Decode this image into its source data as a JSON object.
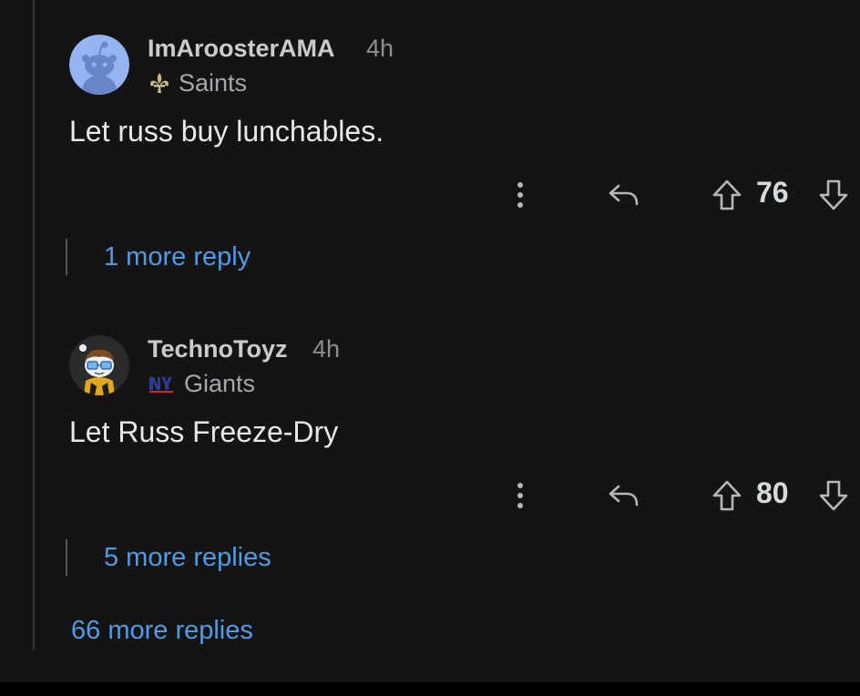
{
  "comments": [
    {
      "username": "ImAroosterAMA",
      "age": "4h",
      "flair": {
        "label": "Saints",
        "icon": "fleur-de-lis-icon"
      },
      "avatar": "default-snoo-avatar",
      "body": "Let russ buy lunchables.",
      "score": "76",
      "more_replies": "1 more reply"
    },
    {
      "username": "TechnoToyz",
      "age": "4h",
      "flair": {
        "label": "Giants",
        "icon": "ny-giants-logo-icon"
      },
      "avatar": "custom-snoo-avatar",
      "body": "Let Russ Freeze-Dry",
      "score": "80",
      "more_replies": "5 more replies"
    }
  ],
  "load_more": "66 more replies",
  "colors": {
    "background": "#141414",
    "link": "#4f9be6",
    "thread_line": "#3a3a3c",
    "avatar_blue": "#94b4f2",
    "saints_gold": "#cbb883",
    "giants_blue": "#2a3c8f"
  }
}
